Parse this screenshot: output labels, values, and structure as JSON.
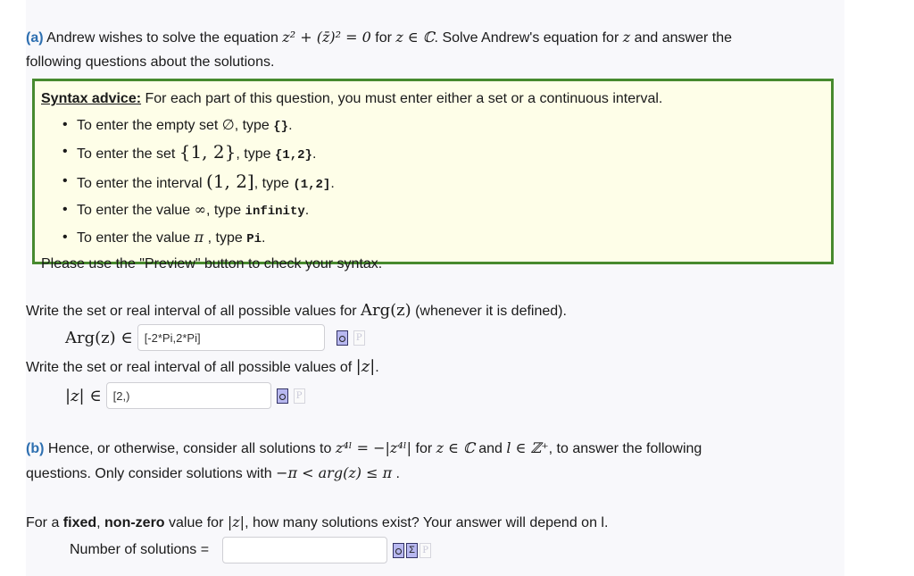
{
  "part_a": {
    "label": "(a)",
    "text_1": " Andrew wishes to solve the equation ",
    "equation": "z² + (z̄)² = 0",
    "text_2": " for ",
    "domain": "z ∈ ℂ",
    "text_3": ". Solve Andrew's equation for ",
    "var": "z",
    "text_4": " and answer the",
    "text_5": "following questions about the solutions."
  },
  "syntax": {
    "heading": "Syntax advice:",
    "intro": " For each part of this question, you must enter either a set or a continuous interval.",
    "items": [
      {
        "pre": "To enter the empty set ",
        "math": "∅",
        "mid": ", type ",
        "code": "{}",
        "post": "."
      },
      {
        "pre": "To enter the set ",
        "math": "{1, 2}",
        "mid": ", type ",
        "code": "{1,2}",
        "post": "."
      },
      {
        "pre": "To enter the interval ",
        "math": "(1, 2]",
        "mid": ", type ",
        "code": "(1,2]",
        "post": "."
      },
      {
        "pre": "To enter the value ",
        "math": "∞",
        "mid": ", type ",
        "code": "infinity",
        "post": "."
      },
      {
        "pre": "To enter the value ",
        "math": "π",
        "mid": " , type ",
        "code": "Pi",
        "post": "."
      }
    ],
    "footer": "Please use the \"Preview\" button to check your syntax."
  },
  "q1": {
    "text": "Write the set or real interval of all possible values for ",
    "math": "Arg(z)",
    "text_after": " (whenever it is defined).",
    "label": "Arg(z) ∈",
    "value": "[-2*Pi,2*Pi]"
  },
  "q2": {
    "text": "Write the set or real interval of all possible values of ",
    "math": "|z|",
    "text_after": ".",
    "label": "|z| ∈",
    "value": "[2,)"
  },
  "part_b": {
    "label": "(b)",
    "text_1": " Hence, or otherwise, consider all solutions to ",
    "equation": "z⁴ˡ = −|z⁴ˡ|",
    "text_2": " for ",
    "domain": "z ∈ ℂ",
    "text_3": "  and ",
    "domain_l": "l ∈ ℤ⁺",
    "text_4": ", to answer the following",
    "text_5": "questions. Only consider solutions with ",
    "range": "−π < arg(z) ≤ π",
    "text_6": " ."
  },
  "q3": {
    "pre": "For a ",
    "bold1": "fixed",
    "mid1": ", ",
    "bold2": "non-zero",
    "mid2": " value for ",
    "math": "|z|",
    "post": ", how many solutions exist? Your answer will depend on l.",
    "label": "Number of solutions =",
    "value": ""
  },
  "icons": {
    "preview": "preview-icon",
    "equation": "sigma-equation-icon",
    "plain": "plain-text-icon",
    "plain_glyph": "P",
    "sigma_glyph": "Σ"
  },
  "colors": {
    "part_label": "#2d6fb0",
    "syntax_border": "#478a2e",
    "syntax_bg": "#fefee8",
    "panel_bg": "#f8f8fb"
  }
}
